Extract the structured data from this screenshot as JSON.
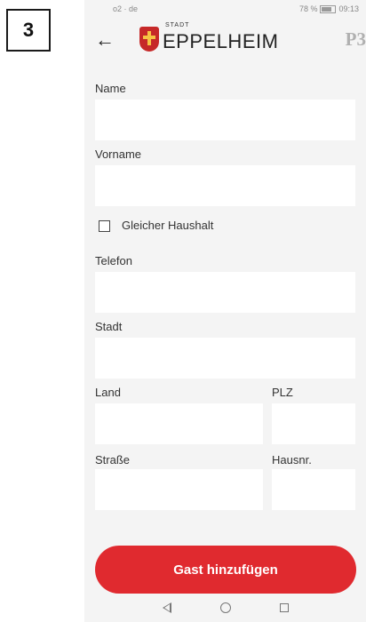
{
  "step_badge": "3",
  "status_bar": {
    "carrier": "o2 · de",
    "battery": "78 %",
    "time": "09:13"
  },
  "header": {
    "logo_small": "STADT",
    "logo_main": "EPPELHEIM",
    "brand_mark": "P3"
  },
  "form": {
    "name_label": "Name",
    "name_value": "",
    "vorname_label": "Vorname",
    "vorname_value": "",
    "household_label": "Gleicher Haushalt",
    "household_checked": false,
    "telefon_label": "Telefon",
    "telefon_value": "",
    "stadt_label": "Stadt",
    "stadt_value": "",
    "land_label": "Land",
    "land_value": "",
    "plz_label": "PLZ",
    "plz_value": "",
    "strasse_label": "Straße",
    "strasse_value": "",
    "hausnr_label": "Hausnr.",
    "hausnr_value": ""
  },
  "submit_label": "Gast hinzufügen",
  "icons": [
    "back-arrow-icon",
    "city-crest-icon",
    "nav-back-icon",
    "nav-home-icon",
    "nav-recents-icon"
  ],
  "colors": {
    "accent": "#e02a2f",
    "background": "#f4f4f4",
    "field": "#ffffff"
  }
}
